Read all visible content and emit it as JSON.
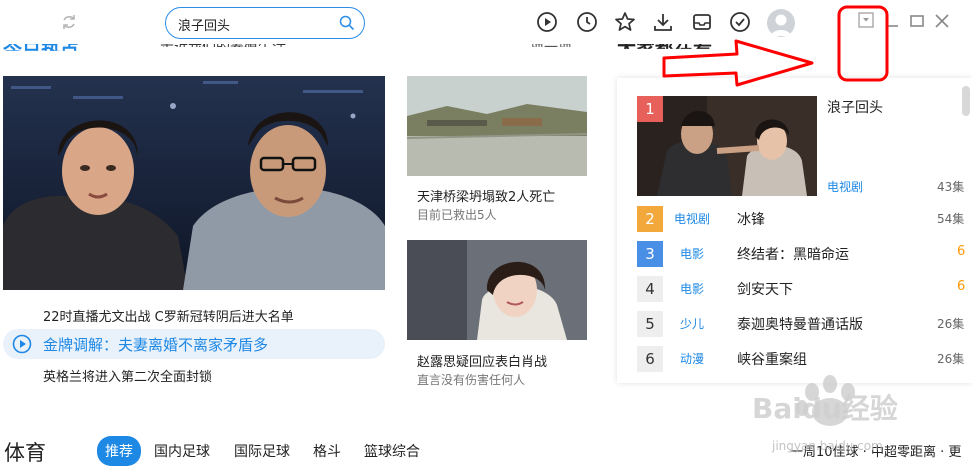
{
  "toolbar": {
    "search_value": "浪子回头",
    "refresh_icon": "refresh-icon",
    "icons": [
      "play-circle-icon",
      "clock-icon",
      "star-icon",
      "download-icon",
      "inbox-icon",
      "check-circle-icon"
    ],
    "avatar": "avatar",
    "window_buttons": [
      "dropdown-icon",
      "minimize-icon",
      "maximize-icon",
      "close-icon"
    ]
  },
  "today": {
    "title": "今日热点",
    "news": "走近我们的养殖生活",
    "refresh": "换一换"
  },
  "hero": {
    "caption_1": "22时直播尤文出战 C罗新冠转阴后进大名单",
    "highlight": "金牌调解：夫妻离婚不离家矛盾多",
    "caption_3": "英格兰将进入第二次全面封锁"
  },
  "cards": [
    {
      "title": "天津桥梁坍塌致2人死亡",
      "sub": "目前已救出5人"
    },
    {
      "title": "赵露思疑回应表白肖战",
      "sub": "直言没有伤害任何人"
    }
  ],
  "ranking": {
    "title": "大家都在看",
    "items": [
      {
        "rank": "1",
        "category": "电视剧",
        "title": "浪子回头",
        "count": "43集",
        "color": "#e8605a"
      },
      {
        "rank": "2",
        "category": "电视剧",
        "title": "冰锋",
        "count": "54集",
        "color": "#f3a83b"
      },
      {
        "rank": "3",
        "category": "电影",
        "title": "终结者：黑暗命运",
        "count": "6",
        "color": "#4a8fe6"
      },
      {
        "rank": "4",
        "category": "电影",
        "title": "剑安天下",
        "count": "6",
        "color": "#eeeeee"
      },
      {
        "rank": "5",
        "category": "少儿",
        "title": "泰迦奥特曼普通话版",
        "count": "26集",
        "color": "#eeeeee"
      },
      {
        "rank": "6",
        "category": "动漫",
        "title": "峡谷重案组",
        "count": "26集",
        "color": "#eeeeee"
      }
    ]
  },
  "sports": {
    "title": "体育",
    "tabs": [
      "推荐",
      "国内足球",
      "国际足球",
      "格斗",
      "篮球综合"
    ],
    "ticker": "一周10佳球 · 中超零距离 · 更"
  },
  "watermark": {
    "text": "Baidu经验",
    "url": "jingyan.baidu.com"
  },
  "colors": {
    "accent": "#1e88e5",
    "annotation": "#ff0000"
  }
}
